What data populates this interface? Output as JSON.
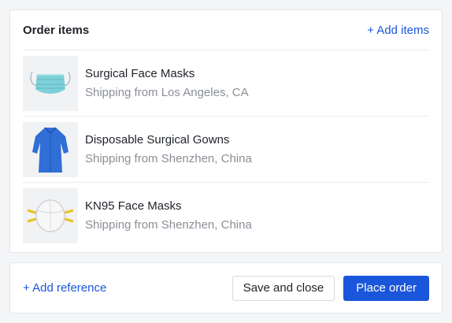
{
  "order_items": {
    "title": "Order items",
    "add_items_label": "+ Add items",
    "items": [
      {
        "name": "Surgical Face Masks",
        "shipping": "Shipping from Los Angeles, CA",
        "image": "surgical-mask-image"
      },
      {
        "name": "Disposable Surgical Gowns",
        "shipping": "Shipping from Shenzhen, China",
        "image": "surgical-gown-image"
      },
      {
        "name": "KN95 Face Masks",
        "shipping": "Shipping from Shenzhen, China",
        "image": "kn95-mask-image"
      }
    ]
  },
  "footer": {
    "add_reference_label": "+ Add reference",
    "save_close_label": "Save and close",
    "place_order_label": "Place order"
  },
  "colors": {
    "accent": "#1a56db",
    "muted_text": "#8a8f96",
    "border": "#e3e5e8"
  }
}
